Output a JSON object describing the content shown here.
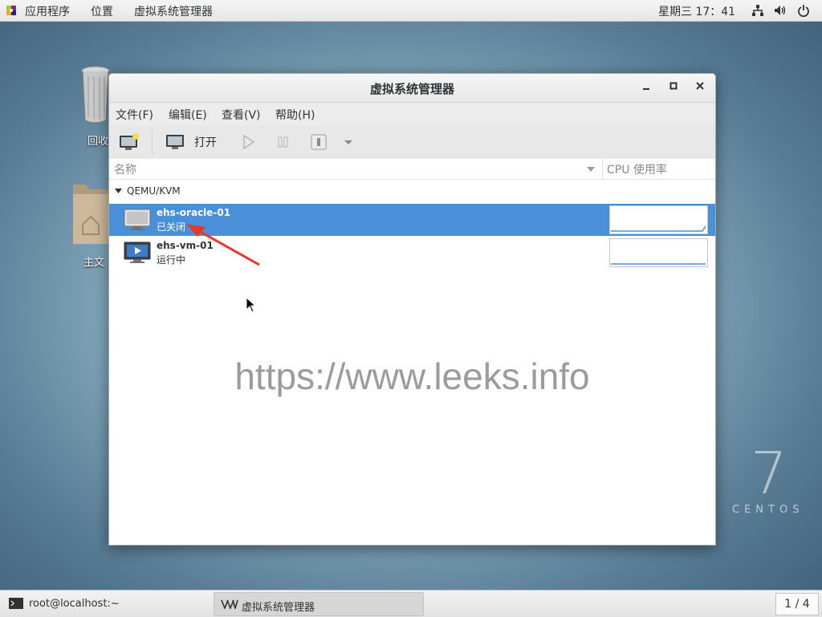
{
  "topbar": {
    "applications": "应用程序",
    "places": "位置",
    "current_app": "虚拟系统管理器",
    "clock": "星期三 17：41"
  },
  "desktop": {
    "trash_label": "回收",
    "home_label": "主文"
  },
  "window": {
    "title": "虚拟系统管理器",
    "menu": [
      "文件(F)",
      "编辑(E)",
      "查看(V)",
      "帮助(H)"
    ],
    "toolbar": {
      "open_label": "打开"
    },
    "columns": {
      "name": "名称",
      "cpu": "CPU 使用率"
    },
    "group": "QEMU/KVM",
    "vms": [
      {
        "name": "ehs-oracle-01",
        "status": "已关闭",
        "selected": true
      },
      {
        "name": "ehs-vm-01",
        "status": "运行中",
        "selected": false
      }
    ],
    "watermark": "https://www.leeks.info"
  },
  "brand": {
    "version": "7",
    "name": "CENTOS"
  },
  "taskbar": {
    "terminal": "root@localhost:~",
    "vmm": "虚拟系统管理器",
    "workspace": "1 / 4"
  },
  "colors": {
    "selection": "#4a90d9",
    "annotation_arrow": "#e8382d"
  }
}
